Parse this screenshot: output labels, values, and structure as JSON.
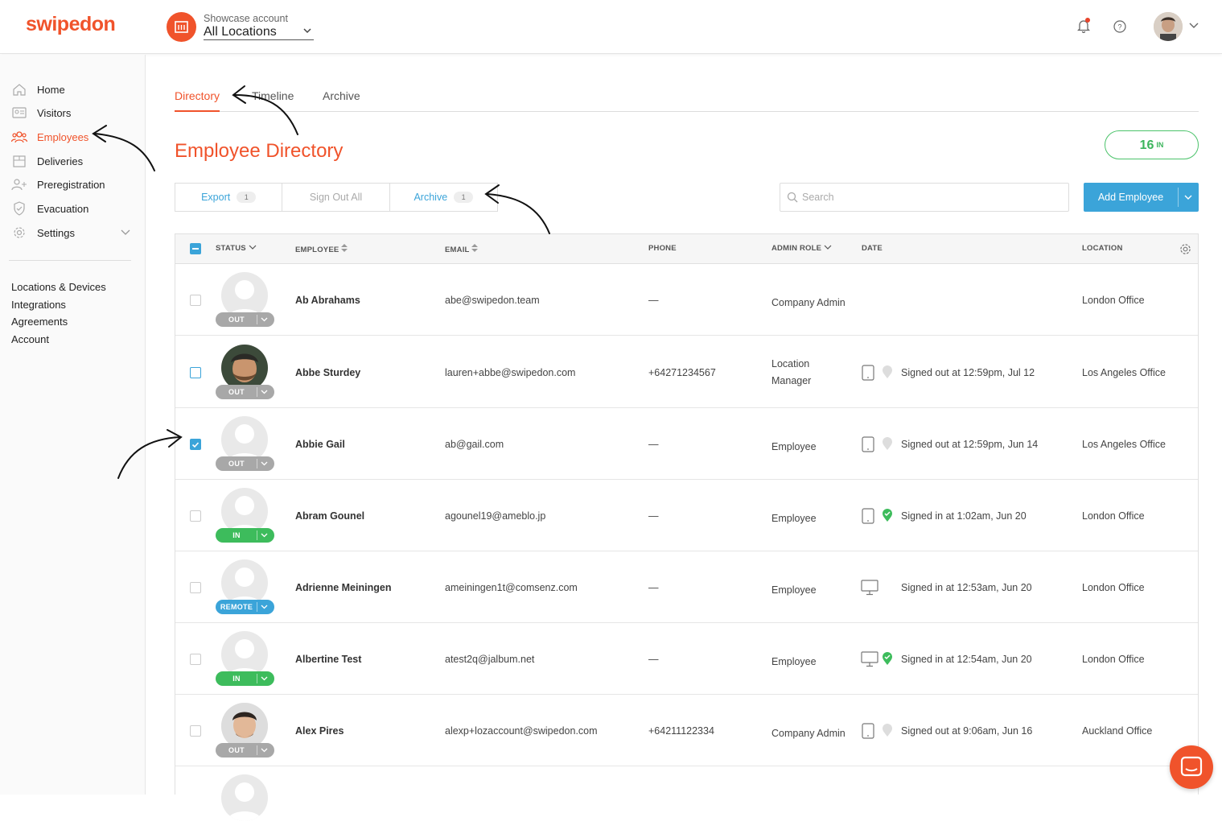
{
  "app": {
    "logo": "swipedon"
  },
  "account": {
    "label": "Showcase account",
    "location": "All Locations"
  },
  "sidebar": {
    "items": [
      {
        "label": "Home",
        "icon": "home-icon"
      },
      {
        "label": "Visitors",
        "icon": "id-card-icon"
      },
      {
        "label": "Employees",
        "icon": "people-icon",
        "active": true
      },
      {
        "label": "Deliveries",
        "icon": "package-icon"
      },
      {
        "label": "Preregistration",
        "icon": "add-user-icon"
      },
      {
        "label": "Evacuation",
        "icon": "shield-icon"
      },
      {
        "label": "Settings",
        "icon": "gear-icon"
      }
    ],
    "links": [
      "Locations & Devices",
      "Integrations",
      "Agreements",
      "Account"
    ]
  },
  "tabs": [
    "Directory",
    "Timeline",
    "Archive"
  ],
  "page": {
    "title": "Employee Directory",
    "in_count": "16",
    "in_label": "IN"
  },
  "toolbar": {
    "export_label": "Export",
    "export_count": "1",
    "signout_label": "Sign Out All",
    "archive_label": "Archive",
    "archive_count": "1",
    "search_placeholder": "Search",
    "add_label": "Add Employee"
  },
  "columns": {
    "status": "STATUS",
    "employee": "EMPLOYEE",
    "email": "EMAIL",
    "phone": "PHONE",
    "admin_role": "ADMIN ROLE",
    "date": "DATE",
    "location": "LOCATION"
  },
  "rows": [
    {
      "status": "OUT",
      "name": "Ab Abrahams",
      "email": "abe@swipedon.team",
      "phone": "—",
      "role": "Company Admin",
      "date": "",
      "location": "London Office"
    },
    {
      "status": "OUT",
      "name": "Abbe Sturdey",
      "email": "lauren+abbe@swipedon.com",
      "phone": "+64271234567",
      "role": "Location Manager",
      "date": "Signed out at 12:59pm, Jul 12",
      "location": "Los Angeles Office"
    },
    {
      "status": "OUT",
      "name": "Abbie Gail",
      "email": "ab@gail.com",
      "phone": "—",
      "role": "Employee",
      "date": "Signed out at 12:59pm, Jun 14",
      "location": "Los Angeles Office"
    },
    {
      "status": "IN",
      "name": "Abram Gounel",
      "email": "agounel19@ameblo.jp",
      "phone": "—",
      "role": "Employee",
      "date": "Signed in at 1:02am, Jun 20",
      "location": "London Office"
    },
    {
      "status": "REMOTE",
      "name": "Adrienne Meiningen",
      "email": "ameiningen1t@comsenz.com",
      "phone": "—",
      "role": "Employee",
      "date": "Signed in at 12:53am, Jun 20",
      "location": "London Office"
    },
    {
      "status": "IN",
      "name": "Albertine Test",
      "email": "atest2q@jalbum.net",
      "phone": "—",
      "role": "Employee",
      "date": "Signed in at 12:54am, Jun 20",
      "location": "London Office"
    },
    {
      "status": "OUT",
      "name": "Alex Pires",
      "email": "alexp+lozaccount@swipedon.com",
      "phone": "+64211122334",
      "role": "Company Admin",
      "date": "Signed out at 9:06am, Jun 16",
      "location": "Auckland Office"
    }
  ],
  "colors": {
    "brand": "#f0532b",
    "accent": "#3ba4d9",
    "in": "#3dbc5c",
    "out": "#a8a8a8"
  }
}
